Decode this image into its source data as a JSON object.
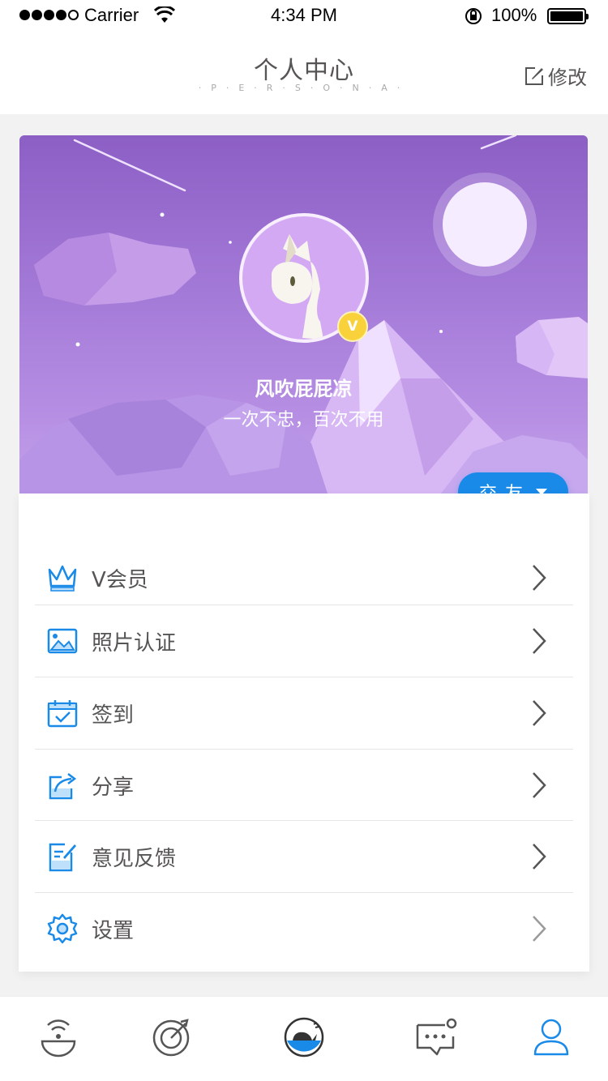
{
  "status_bar": {
    "carrier": "Carrier",
    "time": "4:34 PM",
    "battery": "100%"
  },
  "header": {
    "title": "个人中心",
    "subtitle": "·P·E·R·S·O·N·A·",
    "edit_label": "修改"
  },
  "profile": {
    "name": "风吹屁屁凉",
    "motto": "一次不忠，百次不用",
    "badge": "V",
    "friend_button": "交友"
  },
  "menu": [
    {
      "label": "V会员",
      "icon": "crown-icon"
    },
    {
      "label": "照片认证",
      "icon": "photo-icon"
    },
    {
      "label": "签到",
      "icon": "calendar-check-icon"
    },
    {
      "label": "分享",
      "icon": "share-icon"
    },
    {
      "label": "意见反馈",
      "icon": "feedback-icon"
    },
    {
      "label": "设置",
      "icon": "gear-icon"
    }
  ],
  "tabs": [
    "radar-icon",
    "target-icon",
    "whale-icon",
    "message-icon",
    "profile-icon"
  ],
  "colors": {
    "accent": "#1a8ae8",
    "text": "#565454",
    "banner": "#a47ad8",
    "badge": "#f9d23b"
  }
}
